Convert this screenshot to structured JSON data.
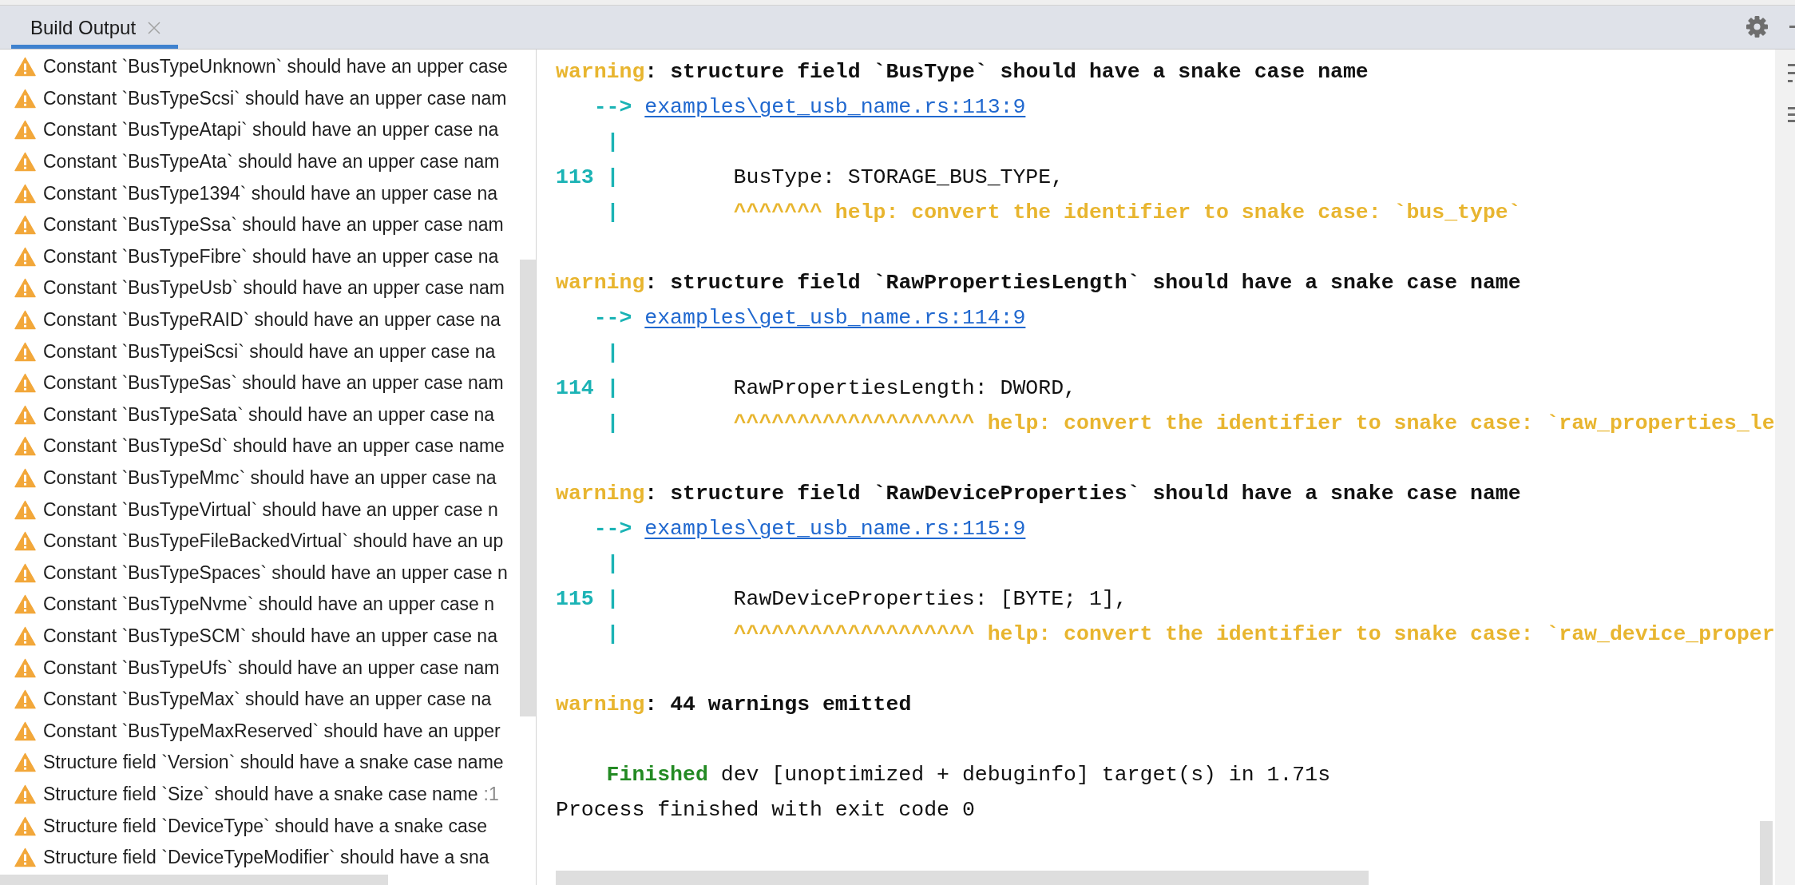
{
  "tabs": [
    {
      "label": "Build Output",
      "selected": true
    }
  ],
  "problems": [
    {
      "text": "Constant `BusTypeUnknown` should have an upper case",
      "selected": false
    },
    {
      "text": "Constant `BusTypeScsi` should have an upper case nam",
      "selected": false
    },
    {
      "text": "Constant `BusTypeAtapi` should have an upper case na",
      "selected": false
    },
    {
      "text": "Constant `BusTypeAta` should have an upper case nam",
      "selected": false
    },
    {
      "text": "Constant `BusType1394` should have an upper case na",
      "selected": false
    },
    {
      "text": "Constant `BusTypeSsa` should have an upper case nam",
      "selected": false
    },
    {
      "text": "Constant `BusTypeFibre` should have an upper case na",
      "selected": false
    },
    {
      "text": "Constant `BusTypeUsb` should have an upper case nam",
      "selected": false
    },
    {
      "text": "Constant `BusTypeRAID` should have an upper case na",
      "selected": false
    },
    {
      "text": "Constant `BusTypeiScsi` should have an upper case na",
      "selected": false
    },
    {
      "text": "Constant `BusTypeSas` should have an upper case nam",
      "selected": false
    },
    {
      "text": "Constant `BusTypeSata` should have an upper case na",
      "selected": false
    },
    {
      "text": "Constant `BusTypeSd` should have an upper case name",
      "selected": false
    },
    {
      "text": "Constant `BusTypeMmc` should have an upper case na",
      "selected": false
    },
    {
      "text": "Constant `BusTypeVirtual` should have an upper case n",
      "selected": false
    },
    {
      "text": "Constant `BusTypeFileBackedVirtual` should have an up",
      "selected": false
    },
    {
      "text": "Constant `BusTypeSpaces` should have an upper case n",
      "selected": false
    },
    {
      "text": "Constant `BusTypeNvme` should have an upper case n",
      "selected": false
    },
    {
      "text": "Constant `BusTypeSCM` should have an upper case na",
      "selected": false
    },
    {
      "text": "Constant `BusTypeUfs` should have an upper case nam",
      "selected": false
    },
    {
      "text": "Constant `BusTypeMax` should have an upper case na",
      "selected": false
    },
    {
      "text": "Constant `BusTypeMaxReserved` should have an upper",
      "selected": false
    },
    {
      "text": "Structure field `Version` should have a snake case name",
      "selected": false
    },
    {
      "text": "Structure field `Size` should have a snake case name",
      "location": ":1",
      "selected": false
    },
    {
      "text": "Structure field `DeviceType` should have a snake case",
      "selected": false
    },
    {
      "text": "Structure field `DeviceTypeModifier` should have a sna",
      "selected": false
    }
  ],
  "output": {
    "diagnostics": [
      {
        "label": "warning",
        "message": ": structure field `BusType` should have a snake case name",
        "arrow": "-->",
        "link": "examples\\get_usb_name.rs:113:9",
        "bars": [
          "|",
          "|",
          "|"
        ],
        "line_number": "113",
        "code": "BusType: STORAGE_BUS_TYPE,",
        "help": "^^^^^^^ help: convert the identifier to snake case: `bus_type`"
      },
      {
        "label": "warning",
        "message": ": structure field `RawPropertiesLength` should have a snake case name",
        "arrow": "-->",
        "link": "examples\\get_usb_name.rs:114:9",
        "bars": [
          "|",
          "|",
          "|"
        ],
        "line_number": "114",
        "code": "RawPropertiesLength: DWORD,",
        "help": "^^^^^^^^^^^^^^^^^^^ help: convert the identifier to snake case: `raw_properties_le"
      },
      {
        "label": "warning",
        "message": ": structure field `RawDeviceProperties` should have a snake case name",
        "arrow": "-->",
        "link": "examples\\get_usb_name.rs:115:9",
        "bars": [
          "|",
          "|",
          "|"
        ],
        "line_number": "115",
        "code": "RawDeviceProperties: [BYTE; 1],",
        "help": "^^^^^^^^^^^^^^^^^^^ help: convert the identifier to snake case: `raw_device_proper"
      }
    ],
    "summary": {
      "label": "warning",
      "message": ": 44 warnings emitted"
    },
    "result": {
      "status": "Finished",
      "details": "dev [unoptimized + debuginfo] target(s) in 1.71s"
    },
    "exit_message": "Process finished with exit code 0"
  }
}
